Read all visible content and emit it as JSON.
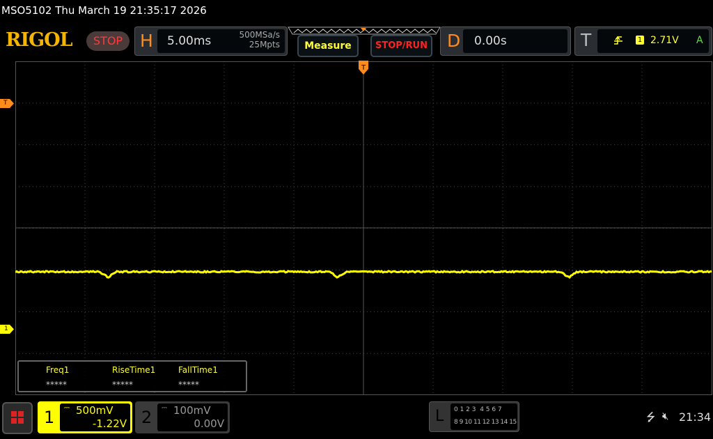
{
  "title": "MSO5102  Thu March 19 21:35:17 2026",
  "logo": "RIGOL",
  "run_state": "STOP",
  "horizontal": {
    "label": "H",
    "timebase": "5.00ms",
    "sample_rate": "500MSa/s",
    "memory_depth": "25Mpts"
  },
  "buttons": {
    "measure": "Measure",
    "stop_run": "STOP/RUN"
  },
  "delay": {
    "label": "D",
    "value": "0.00s"
  },
  "trigger": {
    "label": "T",
    "source": "1",
    "level": "2.71V",
    "mode": "A",
    "edge_icon": "rising-edge-icon"
  },
  "markers": {
    "trigger_level": "T",
    "ch1_ground": "1"
  },
  "measurements": [
    {
      "name": "Freq1",
      "value": "*****"
    },
    {
      "name": "RiseTime1",
      "value": "*****"
    },
    {
      "name": "FallTime1",
      "value": "*****"
    }
  ],
  "channels": [
    {
      "num": "1",
      "scale": "500mV",
      "offset": "-1.22V",
      "color": "#ffff00",
      "active": true
    },
    {
      "num": "2",
      "scale": "100mV",
      "offset": "0.00V",
      "color": "#888888",
      "active": false
    }
  ],
  "logic": {
    "label": "L",
    "row1": "0 1 2 3  4 5 6 7",
    "row2": "8 9 10 11 12 13 14 15"
  },
  "status": {
    "clock": "21:34",
    "usb_icon": "usb-icon",
    "sound_icon": "mute-icon"
  },
  "colors": {
    "trace": "#ffff00",
    "accent": "#ff8c1a"
  }
}
